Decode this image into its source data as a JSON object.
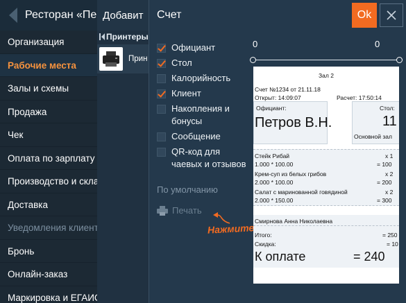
{
  "sidebar": {
    "title": "Ресторан «Пе",
    "items": [
      {
        "label": "Организация"
      },
      {
        "label": "Рабочие места"
      },
      {
        "label": "Залы и схемы"
      },
      {
        "label": "Продажа"
      },
      {
        "label": "Чек"
      },
      {
        "label": "Оплата по зарплату"
      },
      {
        "label": "Производство и склад"
      },
      {
        "label": "Доставка"
      },
      {
        "label": "Уведомления клиенто"
      },
      {
        "label": "Бронь"
      },
      {
        "label": "Онлайн-заказ"
      },
      {
        "label": "Маркировка и ЕГАИС"
      }
    ]
  },
  "middle": {
    "title": "Добавит",
    "section": "Принтеры",
    "printer_name": "Прин"
  },
  "dialog": {
    "title": "Счет",
    "ok_label": "Ok",
    "options": [
      {
        "label": "Официант",
        "checked": true
      },
      {
        "label": "Стол",
        "checked": true
      },
      {
        "label": "Калорийность",
        "checked": false
      },
      {
        "label": "Клиент",
        "checked": true
      },
      {
        "label": "Накопления и бонусы",
        "checked": false
      },
      {
        "label": "Сообщение",
        "checked": false
      },
      {
        "label": "QR-код для чаевых и отзывов",
        "checked": false
      }
    ],
    "defaults_label": "По умолчанию",
    "print_label": "Печать",
    "hint": "Нажмите",
    "slider": {
      "left_value": "0",
      "right_value": "0"
    }
  },
  "receipt": {
    "hall": "Зал 2",
    "bill_line": "Счет №1234 от 21.11.18",
    "opened": "Открыт: 14:09:07",
    "calc": "Расчет: 17:50:14",
    "waiter_label": "Официант:",
    "waiter_name": "Петров В.Н.",
    "table_label": "Стол:",
    "table_number": "11",
    "main_zone": "Основной зал",
    "items": [
      {
        "name": "Стейк Рибай",
        "qty": "x 1",
        "calc": "1.000 * 100.00",
        "sum": "= 100"
      },
      {
        "name": "Крем-суп из белых грибов",
        "qty": "x 2",
        "calc": "2.000 * 100.00",
        "sum": "= 200"
      },
      {
        "name": "Салат с маринованной говядиной",
        "qty": "x 2",
        "calc": "2.000 * 150.00",
        "sum": "= 300"
      }
    ],
    "client": "Смирнова Анна Николаевна",
    "total_label": "Итого:",
    "total_value": "= 250",
    "discount_label": "Скидка:",
    "discount_value": "= 10",
    "pay_label": "К оплате",
    "pay_value": "= 240"
  },
  "colors": {
    "accent": "#f26b21",
    "active_item": "#f5923e",
    "panel": "#24394c"
  },
  "icons": [
    "back-arrow-icon",
    "collapse-icon",
    "printer-icon",
    "check-icon",
    "close-icon",
    "print-icon"
  ]
}
